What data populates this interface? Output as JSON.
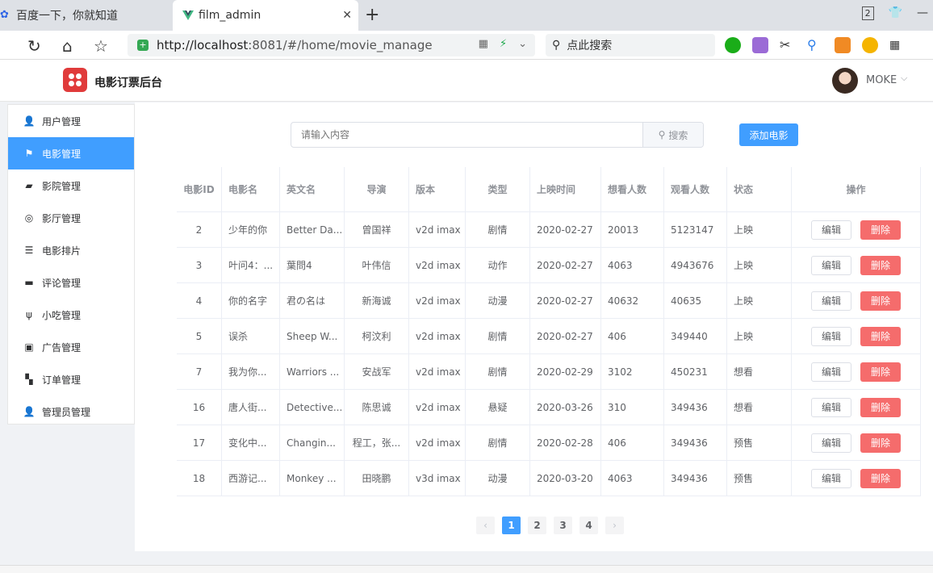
{
  "browser": {
    "tabs": [
      {
        "title": "百度一下，你就知道",
        "active": false
      },
      {
        "title": "film_admin",
        "active": true
      }
    ],
    "tab_count": "2",
    "url_host": "http://localhost",
    "url_rest": ":8081/#/home/movie_manage",
    "search_placeholder": "点此搜索"
  },
  "app": {
    "title": "电影订票后台",
    "user_name": "MOKE"
  },
  "sidebar": {
    "items": [
      {
        "label": "用户管理",
        "icon": "user-icon",
        "glyph": "👤",
        "active": false
      },
      {
        "label": "电影管理",
        "icon": "flag-icon",
        "glyph": "⚑",
        "active": true
      },
      {
        "label": "影院管理",
        "icon": "cinema-icon",
        "glyph": "▰",
        "active": false
      },
      {
        "label": "影厅管理",
        "icon": "hall-icon",
        "glyph": "◎",
        "active": false
      },
      {
        "label": "电影排片",
        "icon": "list-icon",
        "glyph": "☰",
        "active": false
      },
      {
        "label": "评论管理",
        "icon": "comment-icon",
        "glyph": "▬",
        "active": false
      },
      {
        "label": "小吃管理",
        "icon": "fork-knife-icon",
        "glyph": "ψ",
        "active": false
      },
      {
        "label": "广告管理",
        "icon": "ad-icon",
        "glyph": "▣",
        "active": false
      },
      {
        "label": "订单管理",
        "icon": "ticket-icon",
        "glyph": "▚",
        "active": false
      },
      {
        "label": "管理员管理",
        "icon": "admin-icon",
        "glyph": "👤",
        "active": false
      }
    ]
  },
  "toolbar": {
    "search_placeholder": "请输入内容",
    "search_button": "搜索",
    "add_button": "添加电影"
  },
  "table": {
    "headers": [
      "电影ID",
      "电影名",
      "英文名",
      "导演",
      "版本",
      "类型",
      "上映时间",
      "想看人数",
      "观看人数",
      "状态",
      "操作"
    ],
    "edit_label": "编辑",
    "delete_label": "删除",
    "rows": [
      [
        "2",
        "少年的你",
        "Better Da...",
        "曾国祥",
        "v2d imax",
        "剧情",
        "2020-02-27",
        "20013",
        "5123147",
        "上映"
      ],
      [
        "3",
        "叶问4：...",
        "葉問4",
        "叶伟信",
        "v2d imax",
        "动作",
        "2020-02-27",
        "4063",
        "4943676",
        "上映"
      ],
      [
        "4",
        "你的名字",
        "君の名は",
        "新海诚",
        "v2d imax",
        "动漫",
        "2020-02-27",
        "40632",
        "40635",
        "上映"
      ],
      [
        "5",
        "误杀",
        "Sheep W...",
        "柯汶利",
        "v2d imax",
        "剧情",
        "2020-02-27",
        "406",
        "349440",
        "上映"
      ],
      [
        "7",
        "我为你...",
        "Warriors ...",
        "安战军",
        "v2d imax",
        "剧情",
        "2020-02-29",
        "3102",
        "450231",
        "想看"
      ],
      [
        "16",
        "唐人街...",
        "Detective...",
        "陈思诚",
        "v2d imax",
        "悬疑",
        "2020-03-26",
        "310",
        "349436",
        "想看"
      ],
      [
        "17",
        "变化中...",
        "Changin...",
        "程工，张...",
        "v2d imax",
        "剧情",
        "2020-02-28",
        "406",
        "349436",
        "预售"
      ],
      [
        "18",
        "西游记...",
        "Monkey ...",
        "田晓鹏",
        "v3d imax",
        "动漫",
        "2020-03-20",
        "4063",
        "349436",
        "预售"
      ]
    ]
  },
  "pagination": {
    "prev": "‹",
    "next": "›",
    "pages": [
      "1",
      "2",
      "3",
      "4"
    ],
    "current": "1"
  },
  "colors": {
    "primary": "#409eff",
    "danger": "#f56c6c",
    "logo": "#e03b3b"
  }
}
